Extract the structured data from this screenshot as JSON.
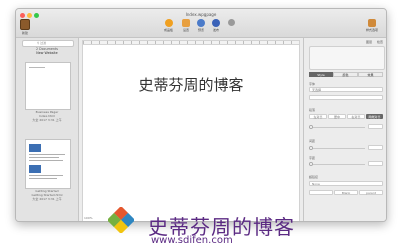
{
  "window": {
    "title": "Index.wpgpage"
  },
  "toolbar": {
    "new_label": "新建",
    "home_label": "成品板",
    "settings_label": "设置",
    "preview_label": "预览",
    "publish_label": "发布",
    "share_label": "",
    "style_label": "样式选项"
  },
  "sidebar": {
    "search_placeholder": "过滤",
    "docs_count": "2 Documents",
    "site_name": "New Website",
    "thumb1": {
      "name": "Business Pager",
      "sub": "Index.html",
      "date": "大全 2017 3:31 上午"
    },
    "thumb2": {
      "name": "Getting Started",
      "sub": "Getting Started.html",
      "date": "大全 2017 3:31 上午"
    }
  },
  "canvas": {
    "heading": "史蒂芬周的博客",
    "zoom": "100%"
  },
  "inspector": {
    "tabs": [
      "",
      "",
      "",
      "",
      "图层",
      "检查"
    ],
    "segments": [
      "Style",
      "颜色",
      "效果"
    ],
    "font_label": "字体",
    "font_value": "无选择",
    "align_label": "段落",
    "align_values": [
      "左对齐",
      "居中",
      "右对齐",
      "两端对齐"
    ],
    "spacing_label": "间距",
    "line_label": "字距",
    "link_label": "超链接",
    "link_value": "None",
    "target_values": [
      "",
      "Blank",
      "parent"
    ]
  },
  "watermark": {
    "text": "史蒂芬周的博客",
    "url": "www.sdifen.com"
  },
  "colors": {
    "accent": "#5b2a83",
    "traffic_red": "#fc605b",
    "traffic_yellow": "#fdbc40",
    "traffic_green": "#34c84a"
  }
}
